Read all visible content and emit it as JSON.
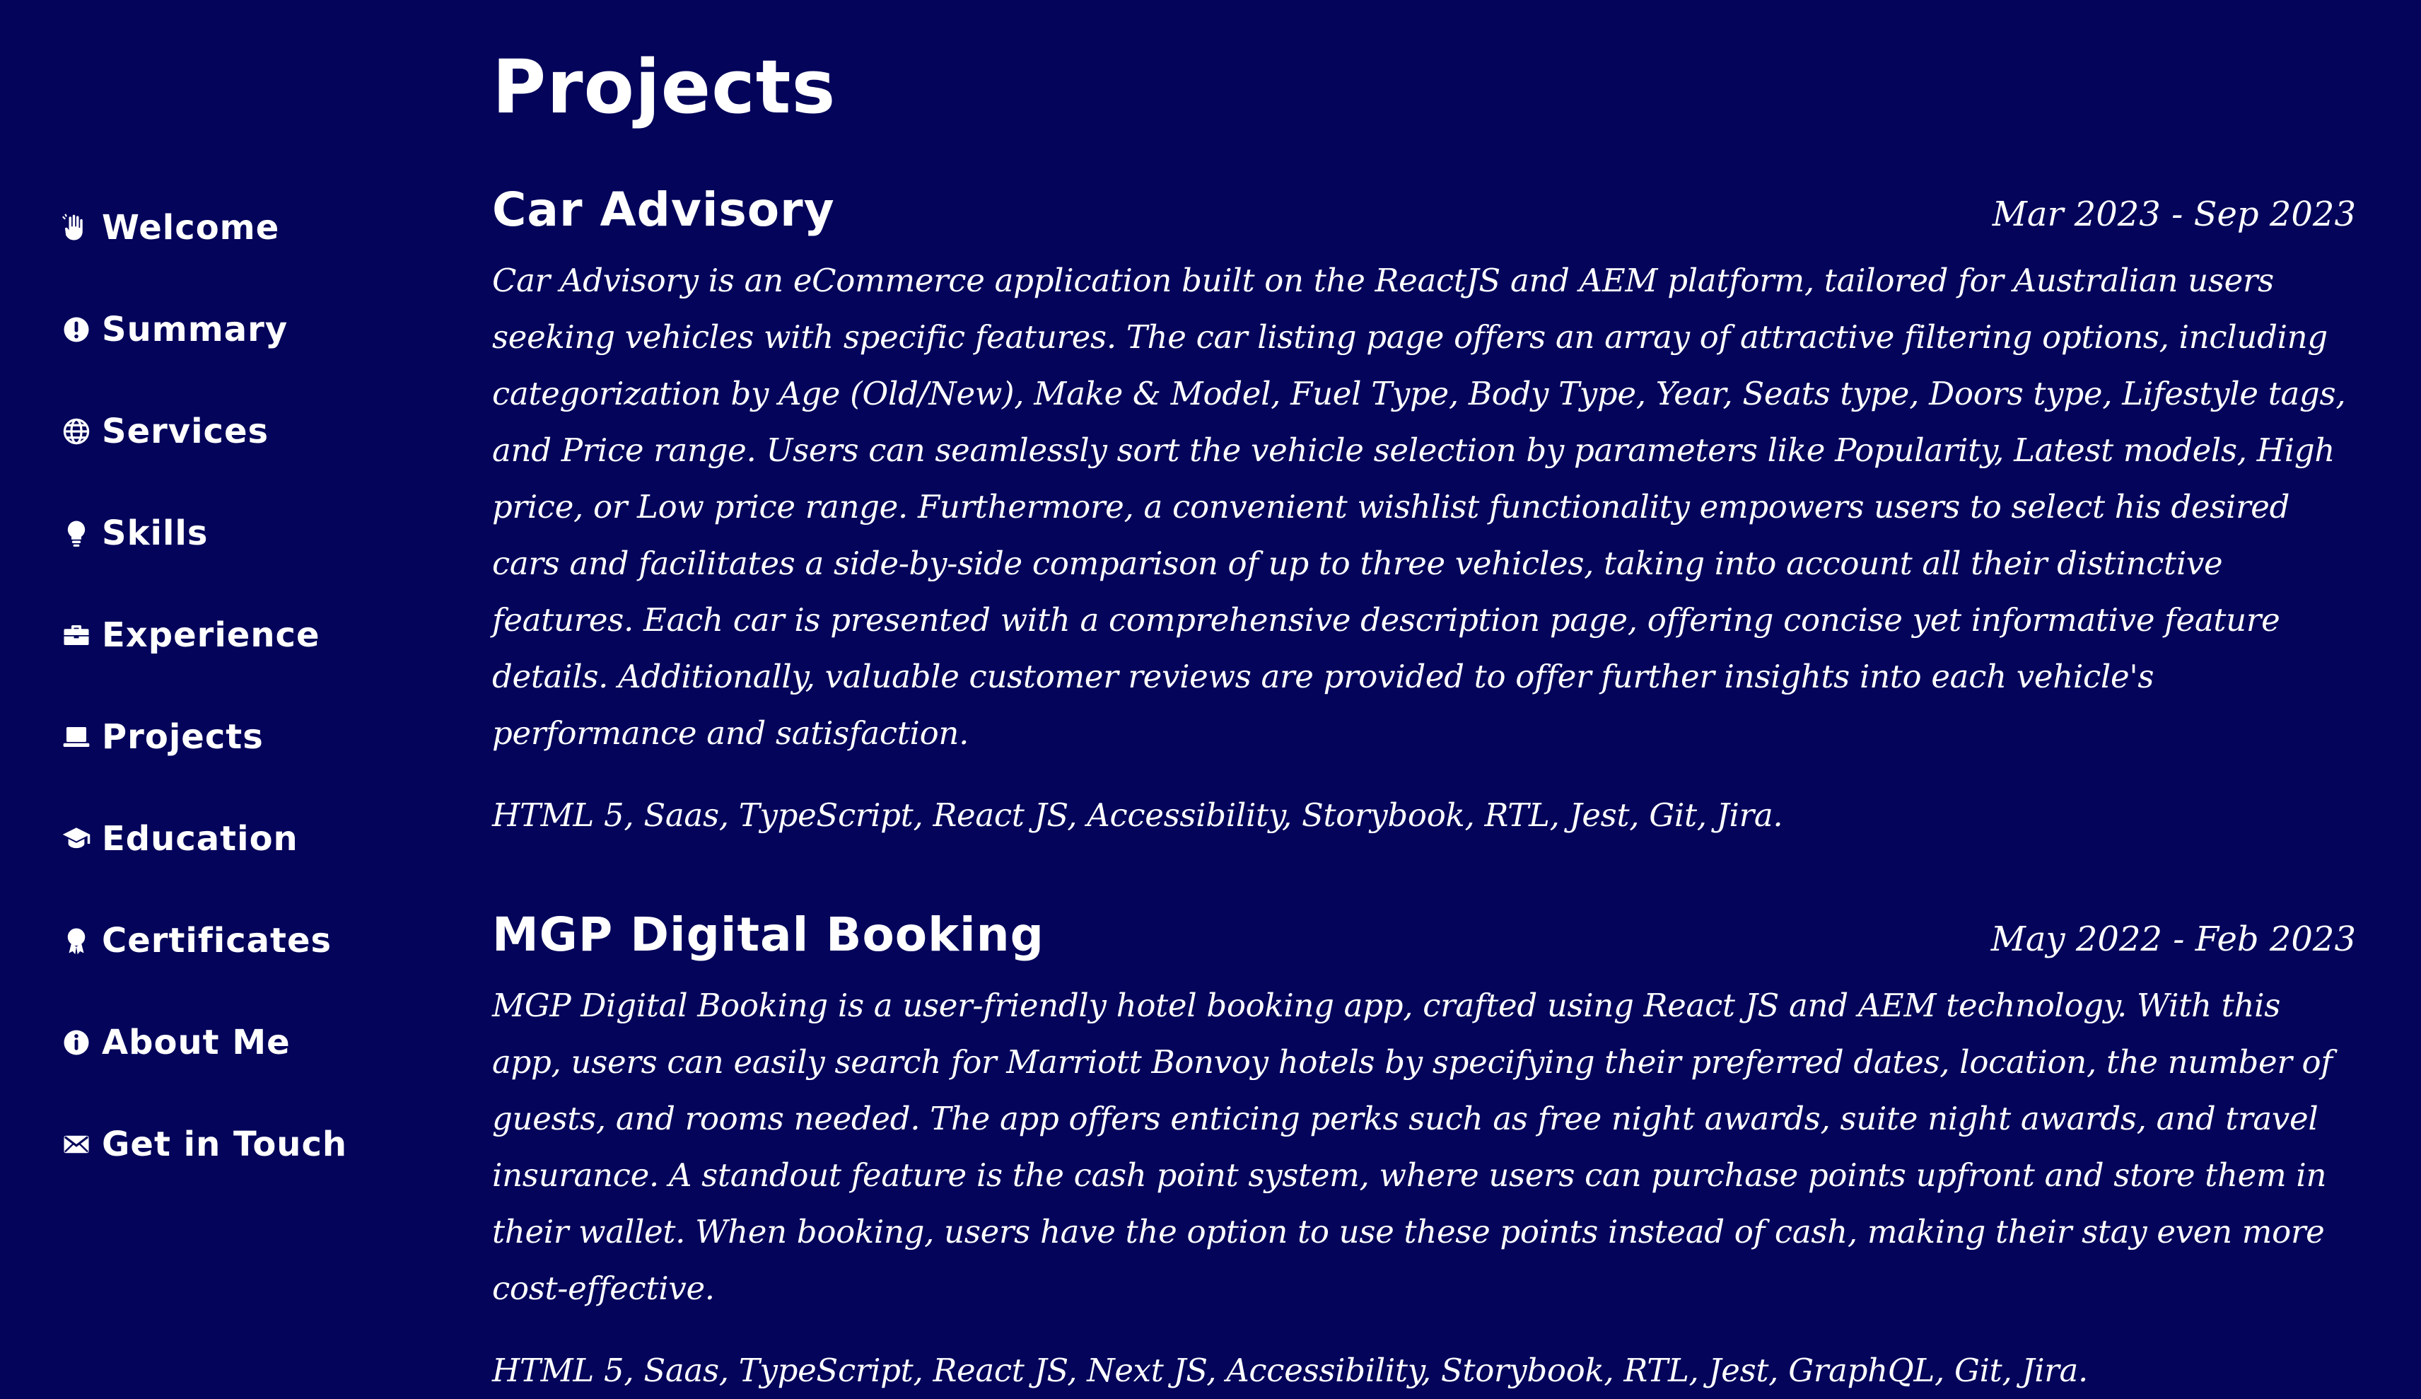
{
  "sidebar": {
    "items": [
      {
        "label": "Welcome",
        "icon": "hand-wave-icon"
      },
      {
        "label": "Summary",
        "icon": "exclamation-circle-icon"
      },
      {
        "label": "Services",
        "icon": "globe-icon"
      },
      {
        "label": "Skills",
        "icon": "lightbulb-icon"
      },
      {
        "label": "Experience",
        "icon": "briefcase-icon"
      },
      {
        "label": "Projects",
        "icon": "laptop-icon"
      },
      {
        "label": "Education",
        "icon": "graduation-cap-icon"
      },
      {
        "label": "Certificates",
        "icon": "award-icon"
      },
      {
        "label": "About Me",
        "icon": "info-circle-icon"
      },
      {
        "label": "Get in Touch",
        "icon": "envelope-icon"
      }
    ]
  },
  "main": {
    "title": "Projects",
    "projects": [
      {
        "title": "Car Advisory",
        "date": "Mar 2023 - Sep 2023",
        "description": "Car Advisory is an eCommerce application built on the ReactJS and AEM platform, tailored for Australian users seeking vehicles with specific features. The car listing page offers an array of attractive filtering options, including categorization by Age (Old/New), Make & Model, Fuel Type, Body Type, Year, Seats type, Doors type, Lifestyle tags, and Price range. Users can seamlessly sort the vehicle selection by parameters like Popularity, Latest models, High price, or Low price range. Furthermore, a convenient wishlist functionality empowers users to select his desired cars and facilitates a side-by-side comparison of up to three vehicles, taking into account all their distinctive features. Each car is presented with a comprehensive description page, offering concise yet informative feature details. Additionally, valuable customer reviews are provided to offer further insights into each vehicle's performance and satisfaction.",
        "tech": "HTML 5, Saas, TypeScript, React JS, Accessibility, Storybook, RTL, Jest, Git, Jira."
      },
      {
        "title": "MGP Digital Booking",
        "date": "May 2022 - Feb 2023",
        "description": "MGP Digital Booking is a user-friendly hotel booking app, crafted using React JS and AEM technology. With this app, users can easily search for Marriott Bonvoy hotels by specifying their preferred dates, location, the number of guests, and rooms needed. The app offers enticing perks such as free night awards, suite night awards, and travel insurance. A standout feature is the cash point system, where users can purchase points upfront and store them in their wallet. When booking, users have the option to use these points instead of cash, making their stay even more cost-effective.",
        "tech": "HTML 5, Saas, TypeScript, React JS, Next JS, Accessibility, Storybook, RTL, Jest, GraphQL, Git, Jira."
      }
    ]
  },
  "colors": {
    "background": "#03045a",
    "text": "#ffffff"
  }
}
